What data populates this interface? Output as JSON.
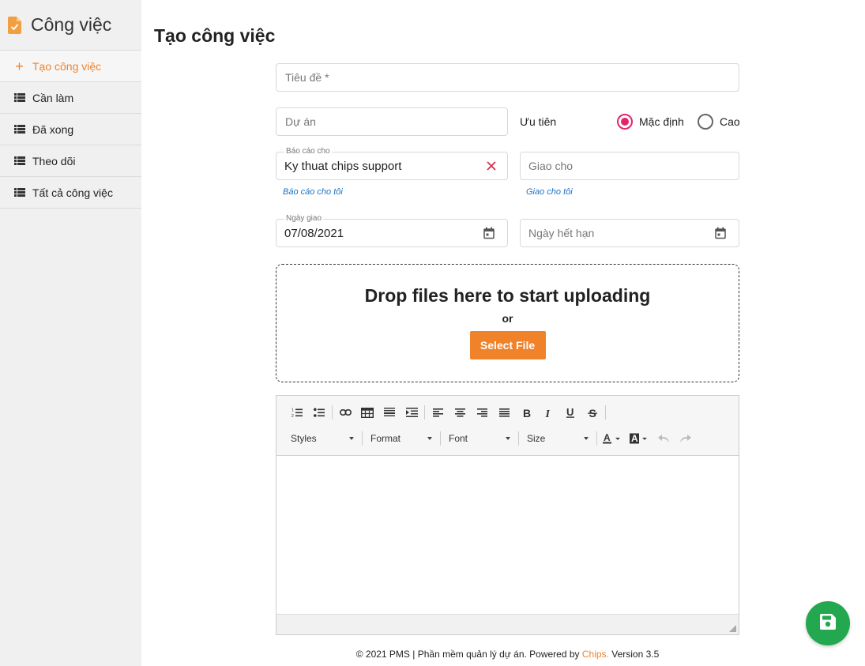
{
  "sidebar": {
    "title": "Công việc",
    "items": [
      {
        "label": "Tạo công việc",
        "active": true
      },
      {
        "label": "Cần làm"
      },
      {
        "label": "Đã xong"
      },
      {
        "label": "Theo dõi"
      },
      {
        "label": "Tất cả công việc"
      }
    ]
  },
  "page": {
    "title": "Tạo công việc"
  },
  "form": {
    "title_placeholder": "Tiêu đề *",
    "project_placeholder": "Dự án",
    "priority_label": "Ưu tiên",
    "priority_options": [
      {
        "label": "Mặc định",
        "checked": true
      },
      {
        "label": "Cao",
        "checked": false
      }
    ],
    "report_to_label": "Báo cáo cho",
    "report_to_value": "Ky thuat chips support",
    "report_to_help": "Báo cáo cho tôi",
    "assign_to_placeholder": "Giao cho",
    "assign_to_help": "Giao cho tôi",
    "assign_date_label": "Ngày giao",
    "assign_date_value": "07/08/2021",
    "due_date_placeholder": "Ngày hết hạn"
  },
  "dropzone": {
    "title": "Drop files here to start uploading",
    "or": "or",
    "button": "Select File"
  },
  "editor": {
    "combos": [
      "Styles",
      "Format",
      "Font",
      "Size"
    ]
  },
  "footer": {
    "prefix": "© 2021 PMS | Phần mềm quản lý dự án. Powered by ",
    "brand": "Chips.",
    "suffix": " Version 3.5"
  },
  "colors": {
    "accent": "#f0822a",
    "radio_checked": "#e2266b",
    "save_button": "#23a84f",
    "help_link": "#1a74c4",
    "clear_icon": "#d32f4f"
  }
}
